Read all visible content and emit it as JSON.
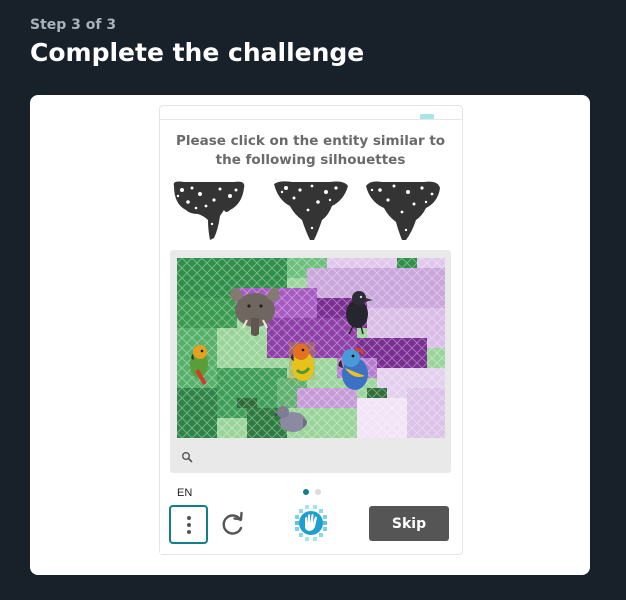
{
  "header": {
    "step": "Step 3 of 3",
    "title": "Complete the challenge"
  },
  "challenge": {
    "prompt": "Please click on the entity similar to the following silhouettes",
    "silhouette_count": 3,
    "scene_subjects": [
      "elephant",
      "crow",
      "parrot",
      "parrot",
      "parrot",
      "pigeon"
    ],
    "language": "EN",
    "skip_label": "Skip",
    "page_count": 2,
    "current_page": 1
  },
  "icons": {
    "zoom": "search-icon",
    "menu": "more-vertical-icon",
    "refresh": "refresh-icon",
    "logo": "hand-logo-icon"
  },
  "colors": {
    "page_background": "#18202a",
    "card_background": "#ffffff",
    "accent": "#0f7f8a",
    "skip_button": "#555555"
  }
}
